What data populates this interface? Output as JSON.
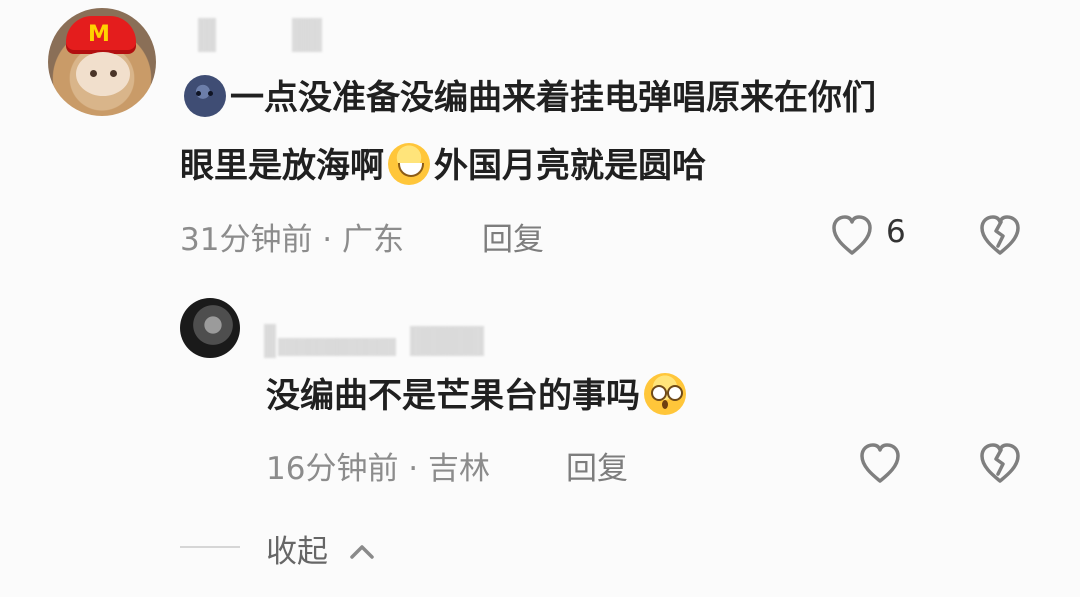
{
  "comment": {
    "line1": "一点没准备没编曲来着挂电弹唱原来在你们",
    "line2_part1": "眼里是放海啊",
    "line2_part2": "外国月亮就是圆哈",
    "time_location": "31分钟前 · 广东",
    "reply_label": "回复",
    "like_count": "6"
  },
  "reply": {
    "text": "没编曲不是芒果台的事吗",
    "time_location": "16分钟前 · 吉林",
    "reply_label": "回复"
  },
  "collapse": {
    "label": "收起"
  },
  "icons": {
    "like": "heart-icon",
    "dislike": "broken-heart-icon",
    "collapse": "chevron-up-icon"
  }
}
